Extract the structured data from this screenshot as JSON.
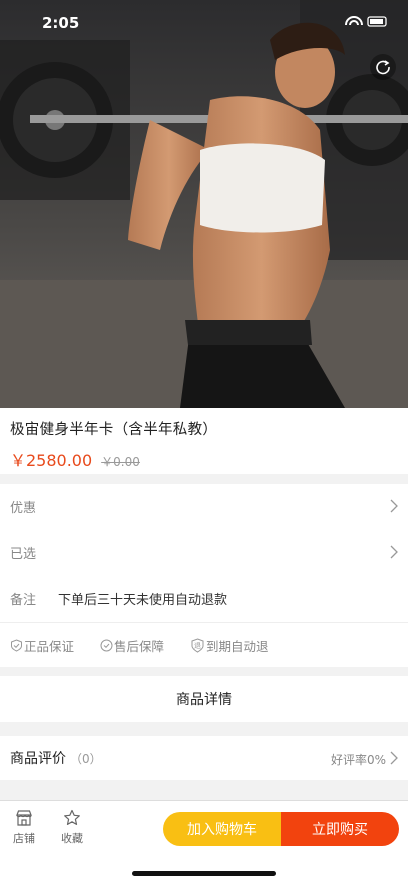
{
  "status": {
    "time": "2:05"
  },
  "hero": {
    "image": "woman-lifting-barbell-photo"
  },
  "product": {
    "title": "极宙健身半年卡（含半年私教）",
    "price": "￥2580.00",
    "original_price": "￥0.00"
  },
  "options": {
    "promo_label": "优惠",
    "selected_label": "已选",
    "note_label": "备注",
    "note_value": "下单后三十天未使用自动退款"
  },
  "guarantees": {
    "genuine": "正品保证",
    "after_sale": "售后保障",
    "auto_refund": "到期自动退"
  },
  "details": {
    "label": "商品详情"
  },
  "reviews": {
    "title": "商品评价",
    "count": "（0）",
    "rate": "好评率0%"
  },
  "bottom": {
    "store_label": "店铺",
    "fav_label": "收藏",
    "cart_label": "加入购物车",
    "buy_label": "立即购买"
  },
  "colors": {
    "accent_red": "#e84a1c",
    "cart_yellow": "#f9bf13",
    "buy_orange": "#f2430e"
  }
}
